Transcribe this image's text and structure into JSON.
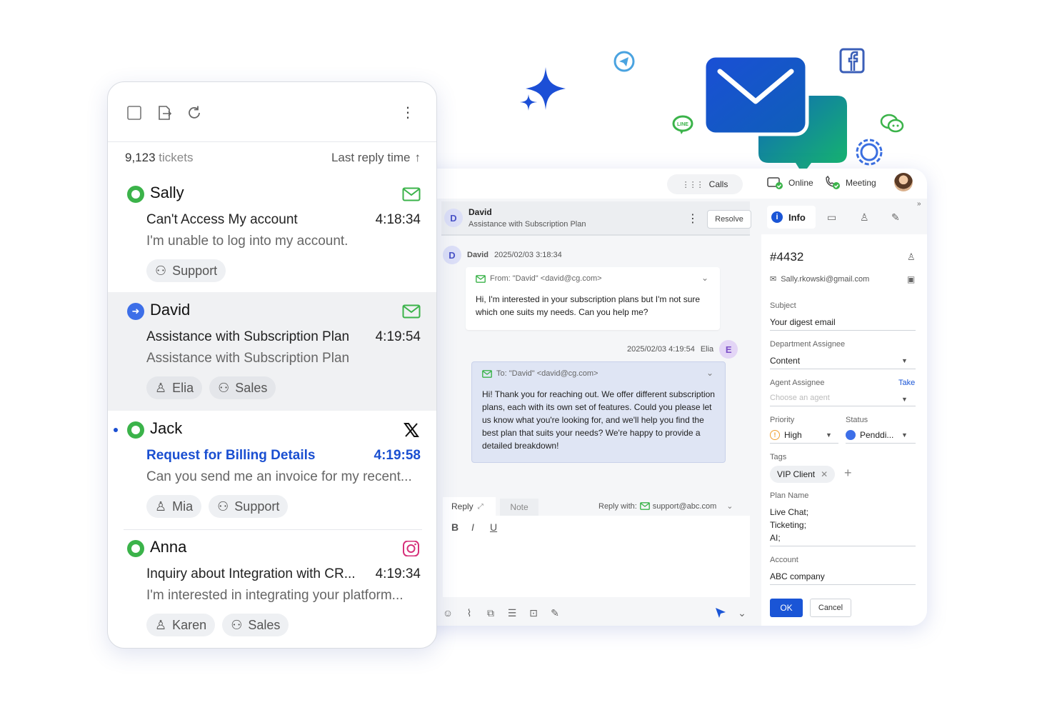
{
  "topbar": {
    "calls_label": "Calls",
    "online_label": "Online",
    "meeting_label": "Meeting"
  },
  "ticket_list": {
    "count_number": "9,123",
    "count_suffix": "tickets",
    "sort_label": "Last reply time",
    "tickets": [
      {
        "name": "Sally",
        "subject": "Can't Access My account",
        "time": "4:18:34",
        "preview": "I'm unable to log into my account.",
        "channel": "email-icon",
        "status": "open",
        "chips": [
          {
            "icon": "team-icon",
            "label": "Support"
          }
        ]
      },
      {
        "name": "David",
        "subject": "Assistance with Subscription Plan",
        "time": "4:19:54",
        "preview": "Assistance with Subscription Plan",
        "channel": "email-icon",
        "status": "forwarded",
        "chips": [
          {
            "icon": "person-icon",
            "label": "Elia"
          },
          {
            "icon": "team-icon",
            "label": "Sales"
          }
        ]
      },
      {
        "name": "Jack",
        "subject": "Request for Billing Details",
        "time": "4:19:58",
        "preview": "Can you send me an invoice for my recent...",
        "channel": "x-icon",
        "status": "open",
        "unread": true,
        "chips": [
          {
            "icon": "person-icon",
            "label": "Mia"
          },
          {
            "icon": "team-icon",
            "label": "Support"
          }
        ]
      },
      {
        "name": "Anna",
        "subject": "Inquiry about Integration with CR...",
        "time": "4:19:34",
        "preview": "I'm interested in integrating your platform...",
        "channel": "instagram-icon",
        "status": "open",
        "chips": [
          {
            "icon": "person-icon",
            "label": "Karen"
          },
          {
            "icon": "team-icon",
            "label": "Sales"
          }
        ]
      }
    ]
  },
  "conversation": {
    "header_initial": "D",
    "header_name": "David",
    "header_subject": "Assistance with Subscription Plan",
    "resolve_label": "Resolve",
    "incoming": {
      "initial": "D",
      "sender": "David",
      "timestamp": "2025/02/03 3:18:34",
      "from_line": "From: \"David\" <david@cg.com>",
      "body": "Hi, I'm interested in your subscription plans but I'm not sure which one suits my needs. Can you help me?"
    },
    "outgoing": {
      "initial": "E",
      "sender": "Elia",
      "timestamp": "2025/02/03 4:19:54",
      "to_line": "To: \"David\" <david@cg.com>",
      "body": "Hi! Thank you for reaching out. We offer different subscription plans, each with its own set of features. Could you please let us know what you're looking for, and we'll help you find the best plan that suits your needs? We're happy to provide a detailed breakdown!"
    },
    "reply": {
      "tab_reply": "Reply",
      "tab_note": "Note",
      "reply_with_label": "Reply with:",
      "reply_with_address": "support@abc.com",
      "bold": "B",
      "italic": "I",
      "underline": "U"
    }
  },
  "info_panel": {
    "tab_info": "Info",
    "ticket_id": "#4432",
    "email": "Sally.rkowski@gmail.com",
    "subject_label": "Subject",
    "subject_value": "Your digest email",
    "dept_label": "Department Assignee",
    "dept_value": "Content",
    "agent_label": "Agent Assignee",
    "agent_take": "Take",
    "agent_placeholder": "Choose an agent",
    "priority_label": "Priority",
    "priority_value": "High",
    "status_label": "Status",
    "status_value": "Penddi...",
    "tags_label": "Tags",
    "tag_value": "VIP Client",
    "plan_label": "Plan Name",
    "plan_lines": [
      "Live Chat;",
      "Ticketing;",
      "AI;"
    ],
    "account_label": "Account",
    "account_value": "ABC company",
    "ok_label": "OK",
    "cancel_label": "Cancel"
  },
  "colors": {
    "accent_blue": "#1a55d6",
    "status_green": "#3bb34a",
    "status_blue": "#3d6fe8",
    "outgoing_bubble": "#dfe5f4",
    "priority_orange": "#f0a030"
  }
}
